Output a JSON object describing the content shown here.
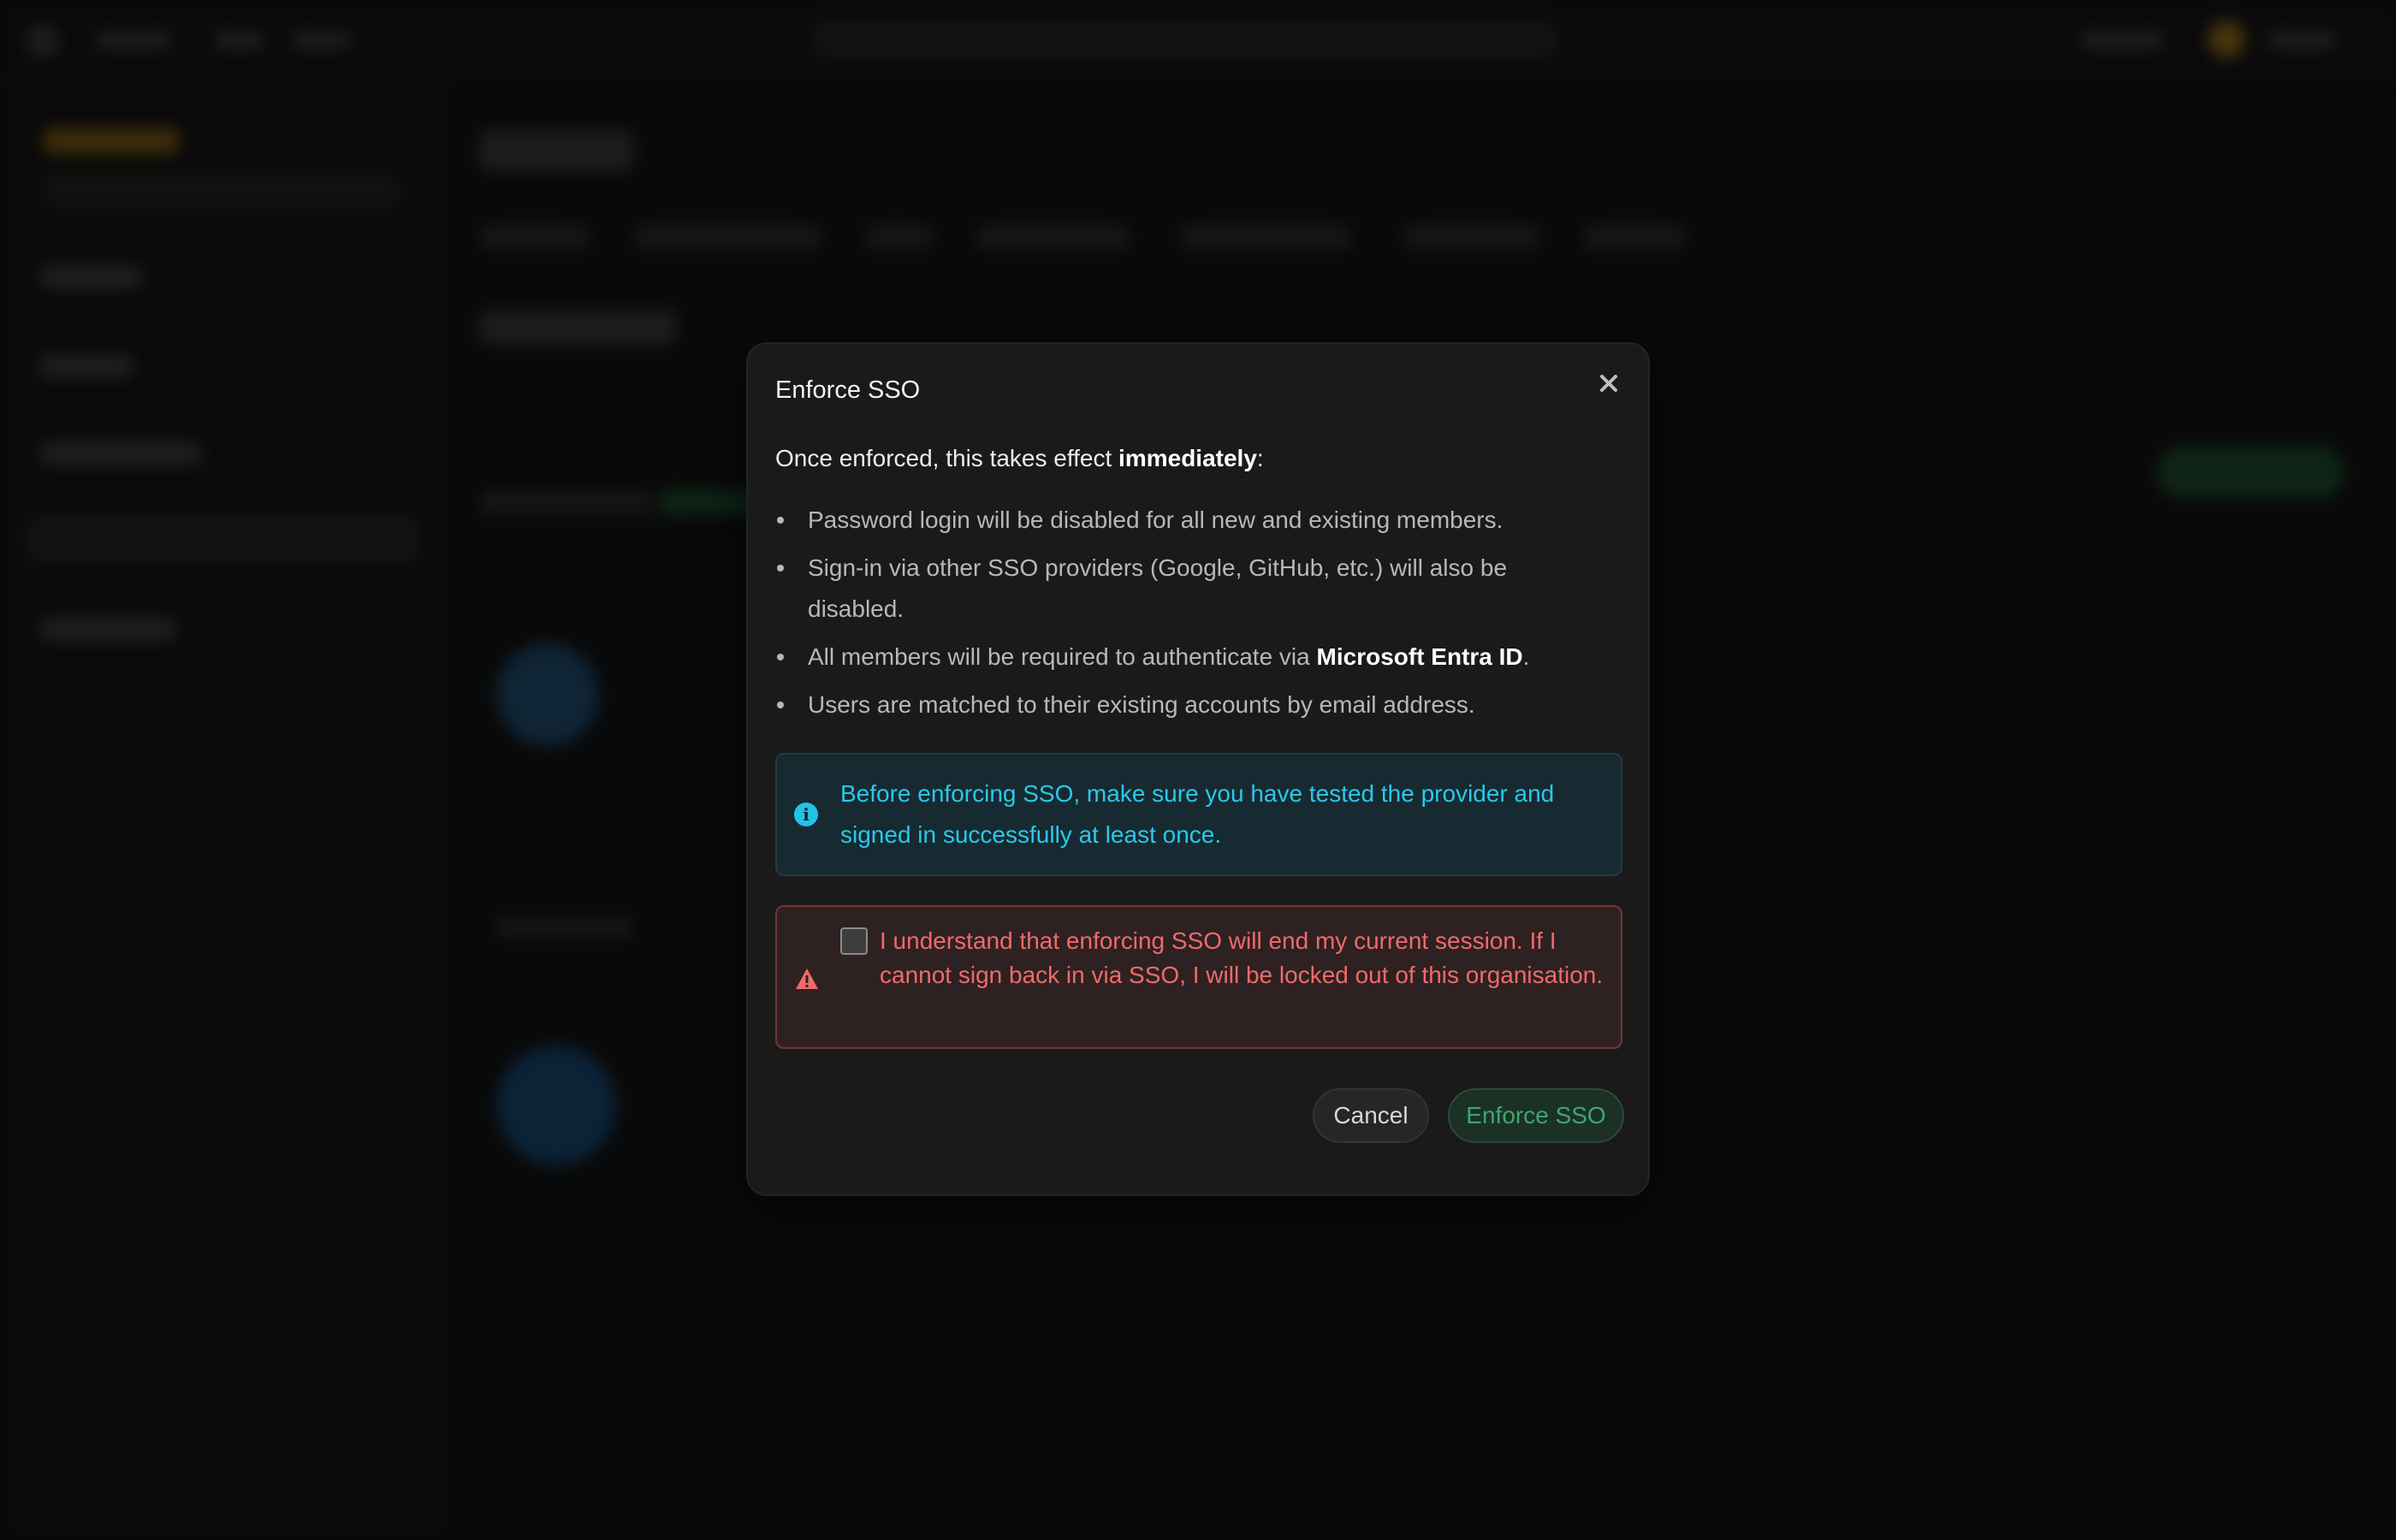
{
  "modal": {
    "title": "Enforce SSO",
    "close_icon": "close-icon",
    "intro_prefix": "Once enforced, this takes effect ",
    "intro_bold": "immediately",
    "intro_suffix": ":",
    "bullets": [
      "Password login will be disabled for all new and existing members.",
      "Sign-in via other SSO providers (Google, GitHub, etc.) will also be disabled.",
      "All members will be required to authenticate via ",
      "Users are matched to their existing accounts by email address."
    ],
    "bullet3_bold": "Microsoft Entra ID",
    "bullet3_suffix": ".",
    "info": {
      "icon": "info-icon",
      "text": "Before enforcing SSO, make sure you have tested the provider and signed in successfully at least once.",
      "color": "#2bc8ea"
    },
    "warning": {
      "icon": "warning-triangle-icon",
      "checked": false,
      "text": "I understand that enforcing SSO will end my current session. If I cannot sign back in via SSO, I will be locked out of this organisation.",
      "color": "#f06a6a"
    },
    "cancel_label": "Cancel",
    "confirm_label": "Enforce SSO",
    "confirm_color": "#3fa56f"
  }
}
